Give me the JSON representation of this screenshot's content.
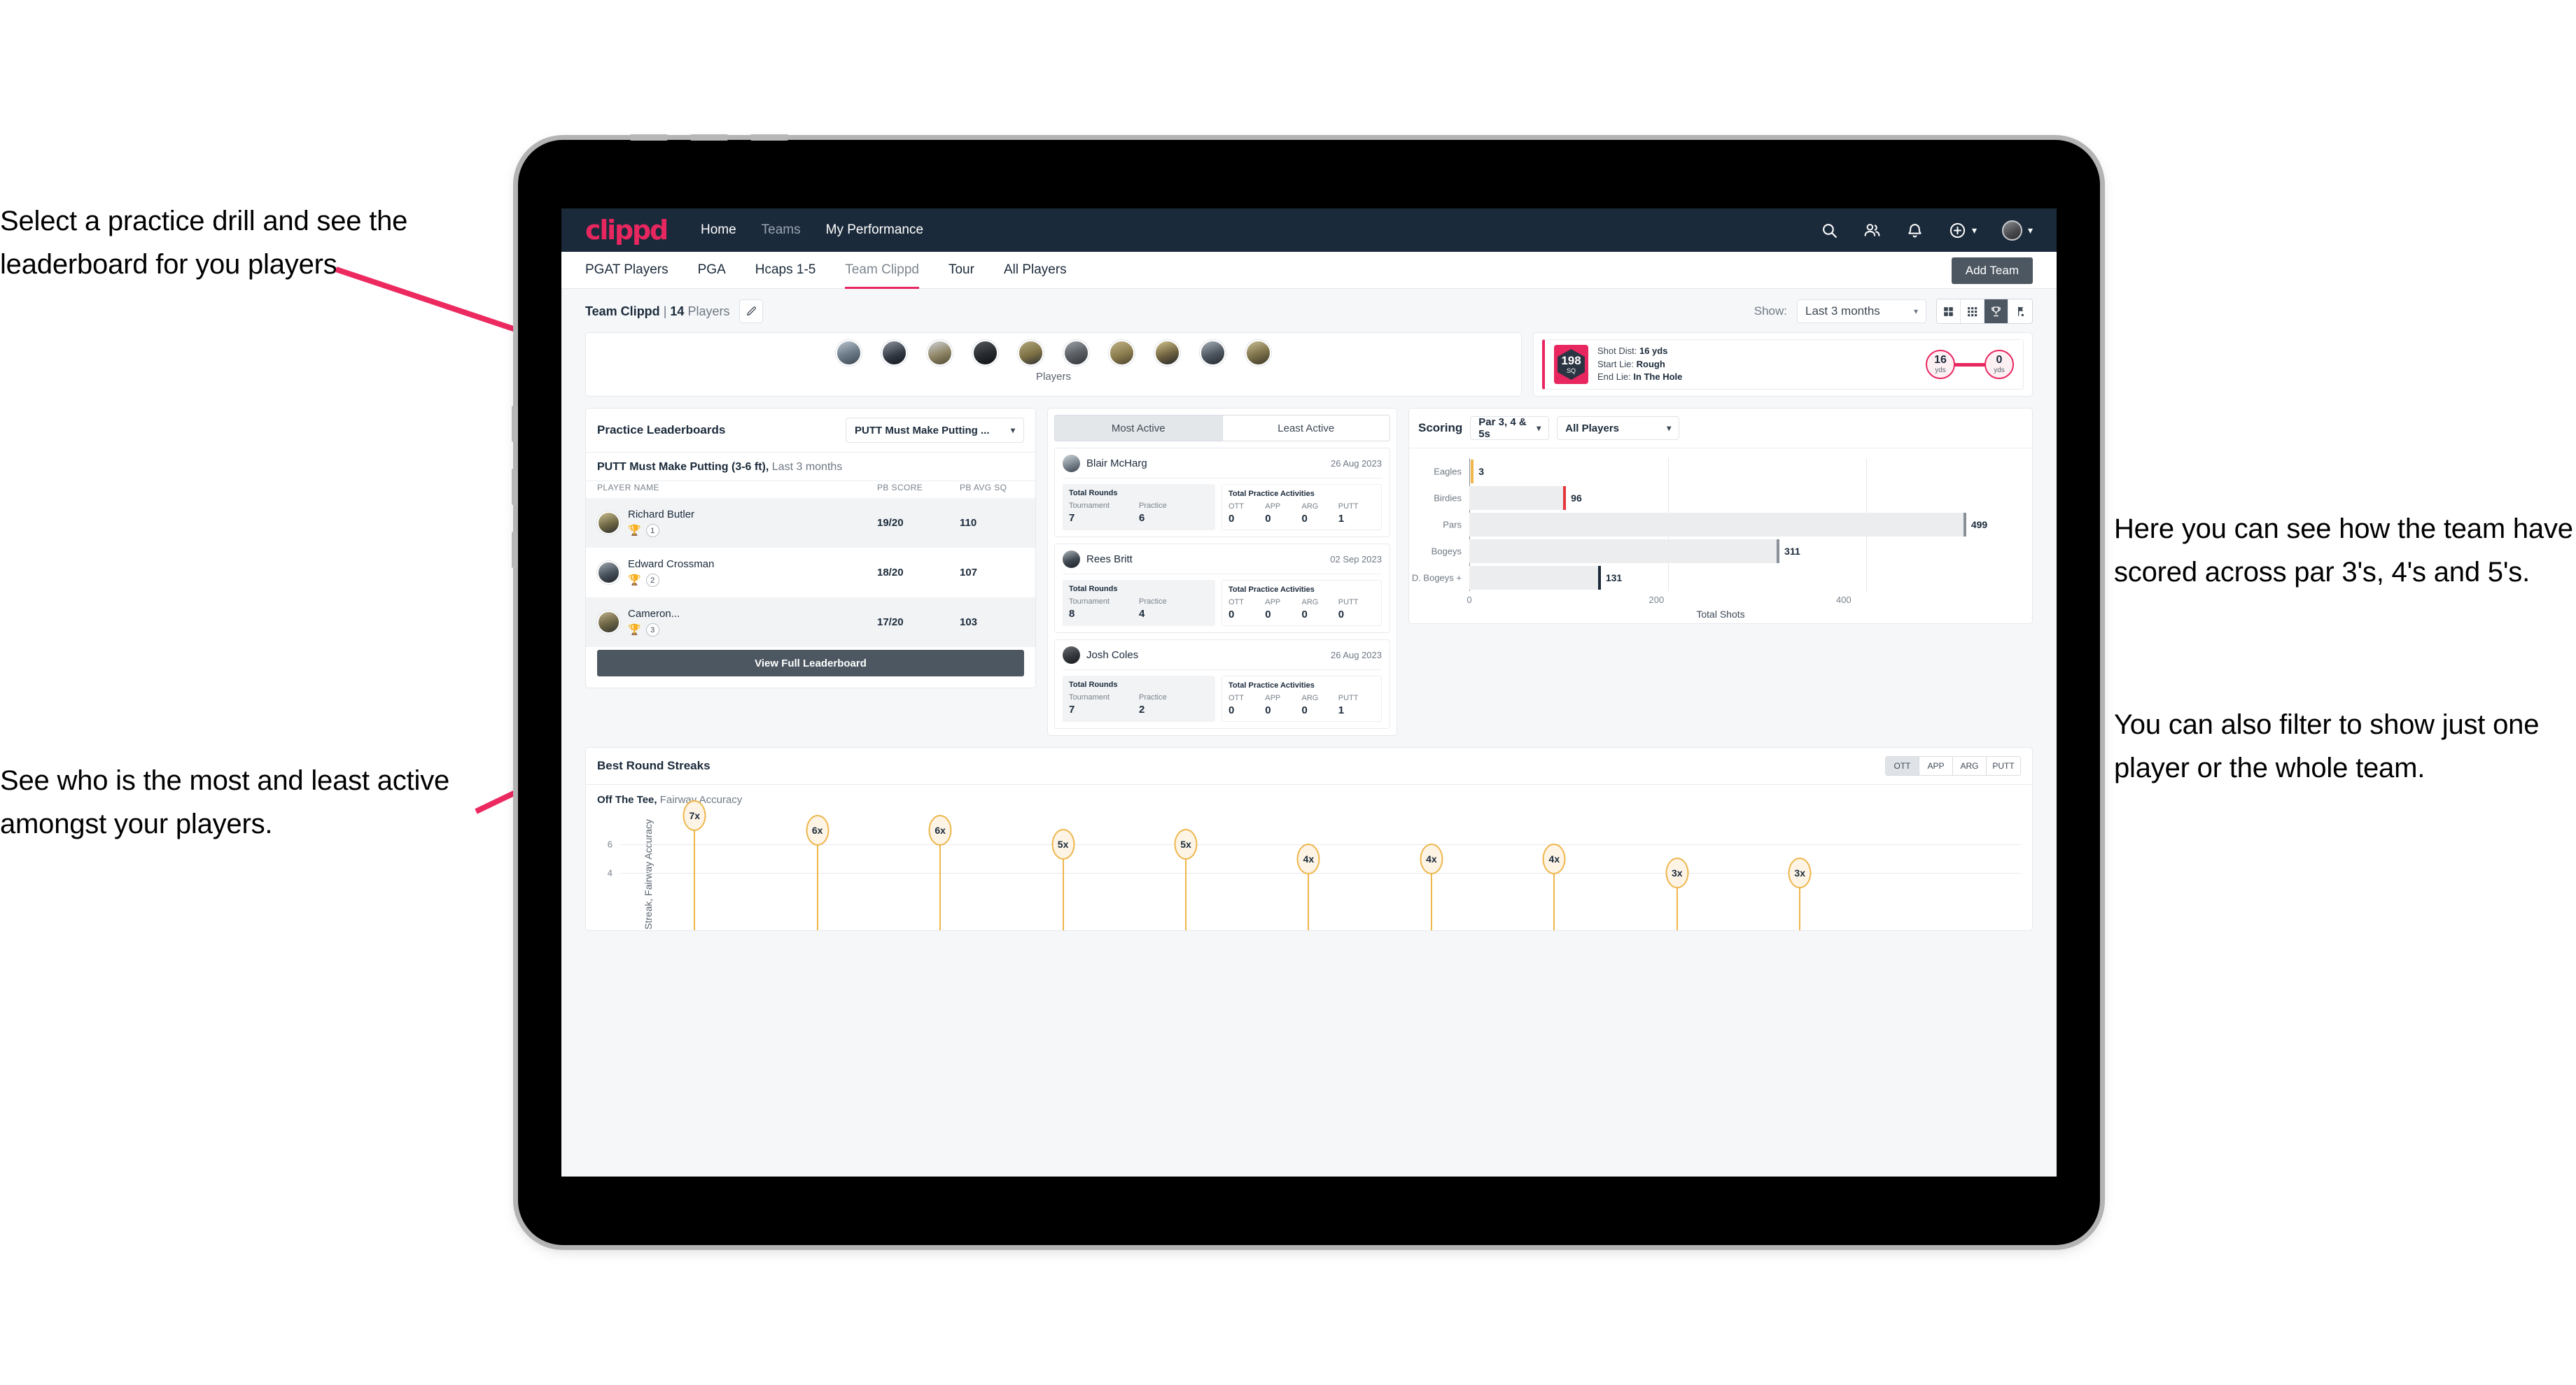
{
  "annotations": {
    "left_top": "Select a practice drill and see the leaderboard for you players.",
    "left_bottom": "See who is the most and least active amongst your players.",
    "right_top": "Here you can see how the team have scored across par 3's, 4's and 5's.",
    "right_bottom": "You can also filter to show just one player or the whole team."
  },
  "colors": {
    "brand_pink": "#e8265f",
    "nav_dark": "#1b2a3a",
    "slate_button": "#4d5761",
    "streak_amber": "#eeb64b",
    "page_bg": "#f6f7f9"
  },
  "topnav": {
    "brand": "clippd",
    "links": [
      {
        "label": "Home",
        "active": true
      },
      {
        "label": "Teams",
        "active": false
      },
      {
        "label": "My Performance",
        "active": true
      }
    ],
    "icons": [
      "search-icon",
      "people-icon",
      "bell-icon",
      "plus-circle-icon",
      "avatar"
    ]
  },
  "subnav": {
    "tabs": [
      {
        "label": "PGAT Players",
        "active": false
      },
      {
        "label": "PGA",
        "active": false
      },
      {
        "label": "Hcaps 1-5",
        "active": false
      },
      {
        "label": "Team Clippd",
        "active": true
      },
      {
        "label": "Tour",
        "active": false
      },
      {
        "label": "All Players",
        "active": false
      }
    ],
    "add_team_label": "Add Team"
  },
  "titlebar": {
    "team_name": "Team Clippd",
    "separator": "|",
    "player_count": "14",
    "players_word": "Players",
    "show_label": "Show:",
    "range_value": "Last 3 months",
    "view_toggles": [
      {
        "name": "grid-large-icon",
        "active": false
      },
      {
        "name": "grid-small-icon",
        "active": false
      },
      {
        "name": "trophy-icon",
        "active": true
      },
      {
        "name": "golf-flag-icon",
        "active": false
      }
    ]
  },
  "players_strip": {
    "caption": "Players",
    "count": 10
  },
  "shot_card": {
    "sq_value": "198",
    "sq_label": "SQ",
    "lines": [
      {
        "label": "Shot Dist:",
        "value": "16 yds"
      },
      {
        "label": "Start Lie:",
        "value": "Rough"
      },
      {
        "label": "End Lie:",
        "value": "In The Hole"
      }
    ],
    "start_ball": {
      "value": "16",
      "unit": "yds"
    },
    "end_ball": {
      "value": "0",
      "unit": "yds"
    }
  },
  "leaderboard": {
    "title": "Practice Leaderboards",
    "drill_select": "PUTT Must Make Putting ...",
    "subtitle_bold": "PUTT Must Make Putting (3-6 ft),",
    "subtitle_soft": "Last 3 months",
    "columns": [
      "PLAYER NAME",
      "PB SCORE",
      "PB AVG SQ"
    ],
    "rows": [
      {
        "name": "Richard Butler",
        "rank": "1",
        "trophy": "gold",
        "score": "19/20",
        "avg_sq": "110"
      },
      {
        "name": "Edward Crossman",
        "rank": "2",
        "trophy": "silver",
        "score": "18/20",
        "avg_sq": "107"
      },
      {
        "name": "Cameron...",
        "rank": "3",
        "trophy": "bronze",
        "score": "17/20",
        "avg_sq": "103"
      }
    ],
    "button_label": "View Full Leaderboard"
  },
  "activity": {
    "tabs": [
      {
        "label": "Most Active",
        "active": true
      },
      {
        "label": "Least Active",
        "active": false
      }
    ],
    "rounds_title": "Total Rounds",
    "rounds_cols": [
      "Tournament",
      "Practice"
    ],
    "practice_title": "Total Practice Activities",
    "practice_cols": [
      "OTT",
      "APP",
      "ARG",
      "PUTT"
    ],
    "items": [
      {
        "name": "Blair McHarg",
        "date": "26 Aug 2023",
        "tournament": "7",
        "practice": "6",
        "ott": "0",
        "app": "0",
        "arg": "0",
        "putt": "1"
      },
      {
        "name": "Rees Britt",
        "date": "02 Sep 2023",
        "tournament": "8",
        "practice": "4",
        "ott": "0",
        "app": "0",
        "arg": "0",
        "putt": "0"
      },
      {
        "name": "Josh Coles",
        "date": "26 Aug 2023",
        "tournament": "7",
        "practice": "2",
        "ott": "0",
        "app": "0",
        "arg": "0",
        "putt": "1"
      }
    ]
  },
  "scoring": {
    "title": "Scoring",
    "par_select": "Par 3, 4 & 5s",
    "player_select": "All Players"
  },
  "streaks": {
    "title": "Best Round Streaks",
    "tabs": [
      {
        "label": "OTT",
        "active": true
      },
      {
        "label": "APP",
        "active": false
      },
      {
        "label": "ARG",
        "active": false
      },
      {
        "label": "PUTT",
        "active": false
      }
    ],
    "subtitle_bold": "Off The Tee,",
    "subtitle_soft": "Fairway Accuracy"
  },
  "chart_data": [
    {
      "type": "bar",
      "orientation": "horizontal",
      "title": "Scoring",
      "categories": [
        "Eagles",
        "Birdies",
        "Pars",
        "Bogeys",
        "D. Bogeys +"
      ],
      "values": [
        3,
        96,
        499,
        311,
        131
      ],
      "bar_cap_colors": [
        "#eeb64b",
        "#e4373c",
        "#8a9099",
        "#8a9099",
        "#1b2a3a"
      ],
      "xlabel": "Total Shots",
      "ylabel": "",
      "xticks": [
        0,
        200,
        400
      ],
      "xlim": [
        0,
        540
      ],
      "grid": true,
      "legend": "none"
    },
    {
      "type": "scatter",
      "title": "Best Round Streaks",
      "subtitle": "Off The Tee, Fairway Accuracy",
      "ylabel": "Streak, Fairway Accuracy",
      "yticks": [
        4,
        6
      ],
      "ylim": [
        0,
        7.8
      ],
      "labels": [
        "7x",
        "6x",
        "6x",
        "5x",
        "5x",
        "4x",
        "4x",
        "4x",
        "3x",
        "3x"
      ],
      "values": [
        7,
        6,
        6,
        5,
        5,
        4,
        4,
        4,
        3,
        3
      ],
      "marker": "pin",
      "marker_color": "#eeb64b",
      "grid": true
    }
  ]
}
